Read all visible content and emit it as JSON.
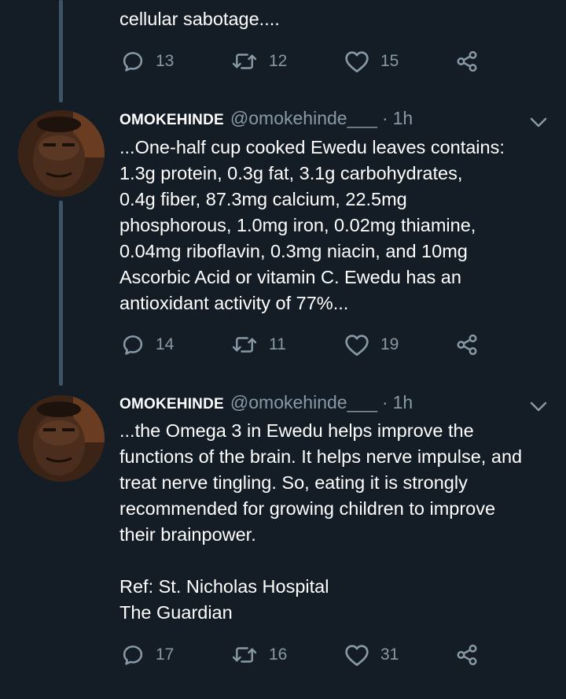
{
  "tweets": [
    {
      "text": "cellular sabotage....",
      "replies": "13",
      "retweets": "12",
      "likes": "15"
    },
    {
      "name": "OMOKEHINDE",
      "handle": "@omokehinde___",
      "separator": "·",
      "time": "1h",
      "text": "...One-half cup cooked Ewedu leaves contains:\n1.3g protein, 0.3g fat, 3.1g carbohydrates,\n0.4g fiber, 87.3mg calcium, 22.5mg\nphosphorous, 1.0mg iron, 0.02mg thiamine,\n0.04mg riboflavin, 0.3mg niacin, and 10mg\nAscorbic Acid or vitamin C. Ewedu has an\nantioxidant activity of 77%...",
      "replies": "14",
      "retweets": "11",
      "likes": "19"
    },
    {
      "name": "OMOKEHINDE",
      "handle": "@omokehinde___",
      "separator": "·",
      "time": "1h",
      "text": "...the Omega 3 in Ewedu helps improve the\nfunctions of the brain. It helps nerve impulse, and\ntreat nerve tingling. So, eating it is strongly\nrecommended for growing children to improve\ntheir brainpower.\n\nRef: St. Nicholas Hospital\n        The Guardian",
      "replies": "17",
      "retweets": "16",
      "likes": "31"
    }
  ],
  "icons": {
    "reply": "reply-icon",
    "retweet": "retweet-icon",
    "like": "heart-icon",
    "share": "share-icon",
    "menu": "chevron-down-icon",
    "avatar": "avatar"
  },
  "colors": {
    "background": "#141d26",
    "secondary_text": "#8899a6",
    "thread_line": "#3d5466"
  }
}
